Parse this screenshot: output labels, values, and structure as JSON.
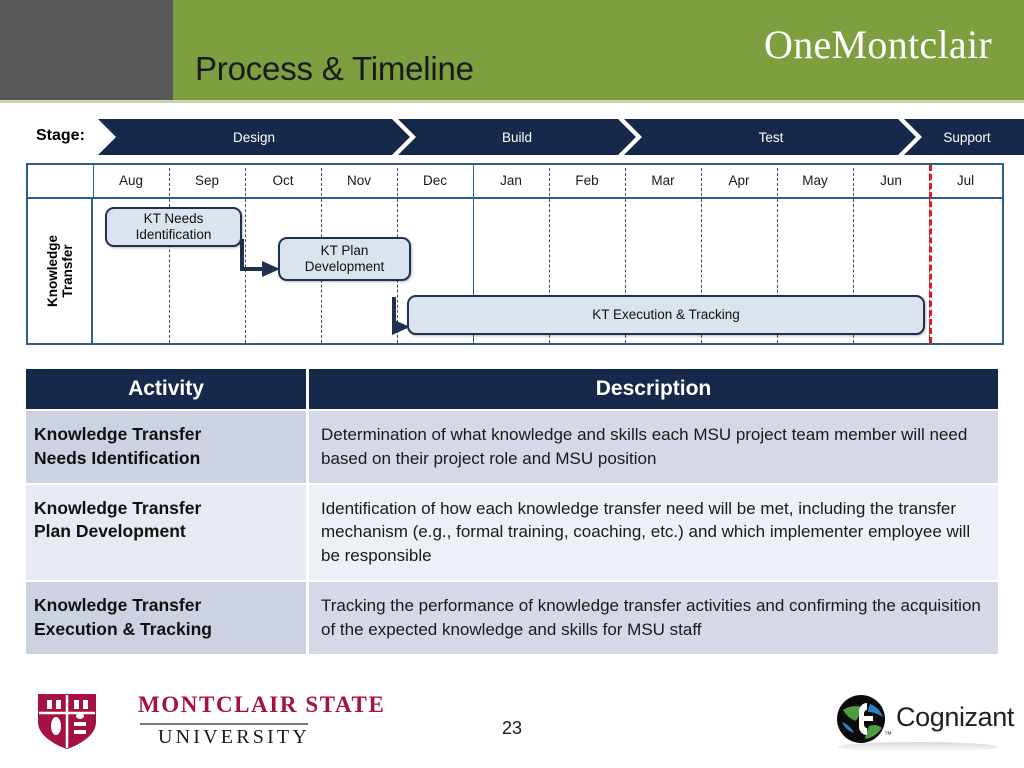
{
  "header": {
    "title": "Process & Timeline",
    "brand": "OneMontclair",
    "green_color": "#7d9f40",
    "gray_color": "#585858"
  },
  "timeline": {
    "stage_label": "Stage:",
    "row_label_line1": "Knowledge",
    "row_label_line2": "Transfer",
    "stages": [
      {
        "name": "Design",
        "start_month": "Aug",
        "end_month": "Dec"
      },
      {
        "name": "Build",
        "start_month": "Jan",
        "end_month": "Feb"
      },
      {
        "name": "Test",
        "start_month": "Mar",
        "end_month": "Jun"
      },
      {
        "name": "Support",
        "start_month": "Jul",
        "end_month": "Jul"
      }
    ],
    "months": [
      "Aug",
      "Sep",
      "Oct",
      "Nov",
      "Dec",
      "Jan",
      "Feb",
      "Mar",
      "Apr",
      "May",
      "Jun",
      "Jul"
    ],
    "milestone_after_month": "Jun",
    "milestone_color": "#e11b22",
    "tasks": [
      {
        "label": "KT Needs\nIdentification",
        "start_month": "Aug",
        "end_month": "Sep",
        "lane": 0
      },
      {
        "label": "KT Plan\nDevelopment",
        "start_month": "Oct",
        "end_month": "Nov",
        "lane": 1
      },
      {
        "label": "KT Execution & Tracking",
        "start_month": "Dec",
        "end_month": "Jun",
        "lane": 2
      }
    ],
    "task_labels": {
      "kt_needs_line1": "KT Needs",
      "kt_needs_line2": "Identification",
      "kt_plan_line1": "KT Plan",
      "kt_plan_line2": "Development",
      "kt_execution": "KT Execution & Tracking"
    },
    "grid_border_color": "#2e5f8a",
    "chevron_color": "#16294a"
  },
  "table": {
    "headers": [
      "Activity",
      "Description"
    ],
    "rows": [
      {
        "activity_line1": "Knowledge Transfer",
        "activity_line2": "Needs Identification",
        "description": "Determination of what knowledge and skills each MSU project team member will need based on their project role and MSU position"
      },
      {
        "activity_line1": "Knowledge Transfer",
        "activity_line2": "Plan Development",
        "description": "Identification of how each knowledge transfer need will be met, including the transfer mechanism (e.g., formal training, coaching, etc.) and which implementer employee will be responsible"
      },
      {
        "activity_line1": "Knowledge Transfer",
        "activity_line2": "Execution & Tracking",
        "description": "Tracking the performance of knowledge transfer activities and confirming the acquisition of the expected knowledge and skills for MSU staff"
      }
    ]
  },
  "footer": {
    "msu_wordmark": "MONTCLAIR STATE",
    "msu_sub": "UNIVERSITY",
    "msu_color": "#a4123f",
    "cognizant_word": "Cognizant",
    "cognizant_tm": "™",
    "slide_number": "23"
  }
}
